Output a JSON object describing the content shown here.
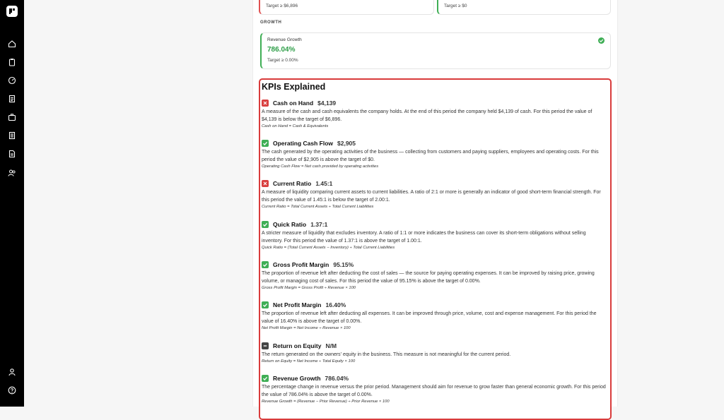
{
  "sidebar": {
    "icons": [
      "logo-icon",
      "home-icon",
      "clipboard-icon",
      "gauge-icon",
      "report-icon",
      "briefcase-icon",
      "document-icon",
      "file-icon",
      "users-icon",
      "user-icon",
      "help-icon"
    ]
  },
  "top_cards": [
    {
      "target": "Target ≥ $6,896",
      "status": "fail"
    },
    {
      "target": "Target ≥ $0",
      "status": "pass"
    }
  ],
  "growth": {
    "section_label": "GROWTH",
    "metric_name": "Revenue Growth",
    "metric_value": "786.04%",
    "target": "Target ≥ 0.00%"
  },
  "kpis_explained": {
    "title": "KPIs Explained",
    "items": [
      {
        "status": "fail",
        "name": "Cash on Hand",
        "value": "$4,139",
        "description": "A measure of the cash and cash equivalents the company holds. At the end of this period the company held $4,139 of cash. For this period the value of $4,139 is below the target of $6,896.",
        "formula": "Cash on Hand = Cash & Equivalents"
      },
      {
        "status": "pass",
        "name": "Operating Cash Flow",
        "value": "$2,905",
        "description": "The cash generated by the operating activities of the business — collecting from customers and paying suppliers, employees and operating costs. For this period the value of $2,905 is above the target of $0.",
        "formula": "Operating Cash Flow = Net cash provided by operating activities"
      },
      {
        "status": "fail",
        "name": "Current Ratio",
        "value": "1.45:1",
        "description": "A measure of liquidity comparing current assets to current liabilities. A ratio of 2:1 or more is generally an indicator of good short-term financial strength. For this period the value of 1.45:1 is below the target of 2.00:1.",
        "formula": "Current Ratio = Total Current Assets ÷ Total Current Liabilities"
      },
      {
        "status": "pass",
        "name": "Quick Ratio",
        "value": "1.37:1",
        "description": "A stricter measure of liquidity that excludes inventory. A ratio of 1:1 or more indicates the business can cover its short-term obligations without selling inventory. For this period the value of 1.37:1 is above the target of 1.00:1.",
        "formula": "Quick Ratio = (Total Current Assets − Inventory) ÷ Total Current Liabilities"
      },
      {
        "status": "pass",
        "name": "Gross Profit Margin",
        "value": "95.15%",
        "description": "The proportion of revenue left after deducting the cost of sales — the source for paying operating expenses. It can be improved by raising price, growing volume, or managing cost of sales. For this period the value of 95.15% is above the target of 0.00%.",
        "formula": "Gross Profit Margin = Gross Profit ÷ Revenue × 100"
      },
      {
        "status": "pass",
        "name": "Net Profit Margin",
        "value": "16.40%",
        "description": "The proportion of revenue left after deducting all expenses. It can be improved through price, volume, cost and expense management. For this period the value of 16.40% is above the target of 0.00%.",
        "formula": "Net Profit Margin = Net Income ÷ Revenue × 100"
      },
      {
        "status": "na",
        "name": "Return on Equity",
        "value": "N/M",
        "description": "The return generated on the owners' equity in the business. This measure is not meaningful for the current period.",
        "formula": "Return on Equity = Net Income ÷ Total Equity × 100"
      },
      {
        "status": "pass",
        "name": "Revenue Growth",
        "value": "786.04%",
        "description": "The percentage change in revenue versus the prior period. Management should aim for revenue to grow faster than general economic growth. For this period the value of 786.04% is above the target of 0.00%.",
        "formula": "Revenue Growth = (Revenue − Prior Revenue) ÷ Prior Revenue × 100"
      }
    ]
  },
  "colors": {
    "fail": "#d94040",
    "pass": "#3fae55",
    "na": "#444444",
    "accent_border": "#d93b3b"
  }
}
